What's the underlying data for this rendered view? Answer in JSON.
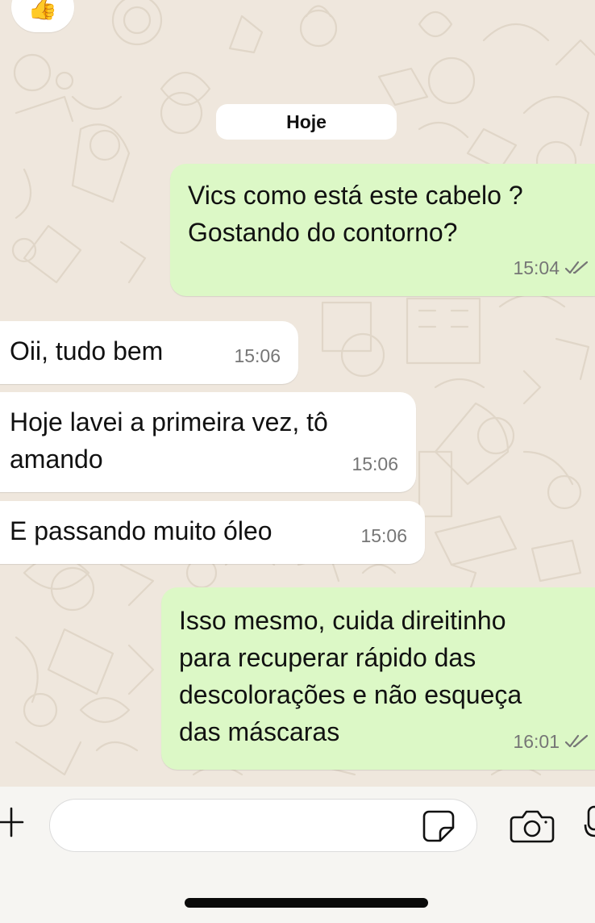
{
  "colors": {
    "chat_background": "#efe7dd",
    "outgoing_bubble": "#dcf8c6",
    "incoming_bubble": "#ffffff",
    "read_ticks": "#767676",
    "timestamp": "#767676"
  },
  "reaction": {
    "emoji": "👍",
    "icon": "thumbs-up-emoji"
  },
  "date_divider": {
    "label": "Hoje"
  },
  "messages": [
    {
      "direction": "outgoing",
      "text": "Vics como está este cabelo ?\nGostando do contorno?",
      "time": "15:04",
      "status": "read"
    },
    {
      "direction": "incoming",
      "text": "Oii, tudo bem",
      "time": "15:06"
    },
    {
      "direction": "incoming",
      "text": "Hoje lavei a primeira vez, tô\namando",
      "time": "15:06"
    },
    {
      "direction": "incoming",
      "text": "E passando muito óleo",
      "time": "15:06"
    },
    {
      "direction": "outgoing",
      "text": "Isso mesmo, cuida direitinho\npara recuperar rápido das\ndescolorações e não esqueça\ndas máscaras",
      "time": "16:01",
      "status": "read"
    }
  ],
  "composer": {
    "attach_icon": "plus-icon",
    "input_value": "",
    "sticker_icon": "sticker-icon",
    "camera_icon": "camera-icon",
    "mic_icon": "microphone-icon"
  }
}
